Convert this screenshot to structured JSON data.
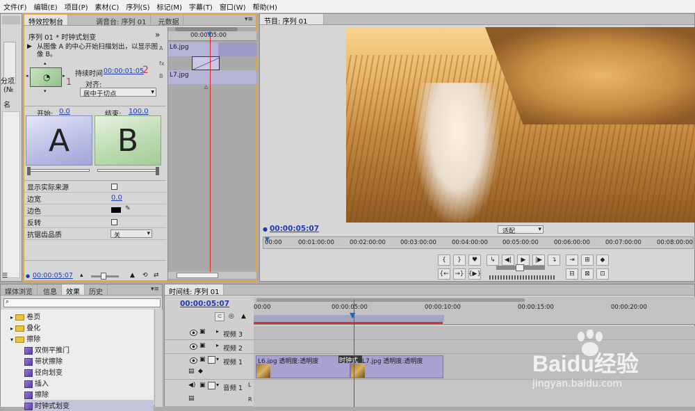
{
  "menu": [
    "文件(F)",
    "编辑(E)",
    "项目(P)",
    "素材(C)",
    "序列(S)",
    "标记(M)",
    "字幕(T)",
    "窗口(W)",
    "帮助(H)"
  ],
  "effect_controls": {
    "tabs": [
      "特效控制台",
      "调音台: 序列 01",
      "元数据"
    ],
    "title": "序列 01 * 时钟式划变",
    "description": "从图像 A 的中心开始扫描划出，以显示图像 B。",
    "duration_label": "持续时间",
    "duration_value": "00:00:01:05",
    "align_label": "对齐:",
    "align_value": "居中于切点",
    "annotation_1": "1",
    "annotation_2": "2",
    "start_label": "开始:",
    "start_value": "0.0",
    "end_label": "结束:",
    "end_value": "100.0",
    "preview_a": "A",
    "preview_b": "B",
    "props": [
      {
        "label": "显示实际来源",
        "type": "check"
      },
      {
        "label": "边宽",
        "type": "value",
        "value": "0.0"
      },
      {
        "label": "边色",
        "type": "color"
      },
      {
        "label": "反转",
        "type": "check"
      },
      {
        "label": "抗锯齿品质",
        "type": "select",
        "value": "关"
      }
    ],
    "time": "00:00:05:07",
    "mini_timeline": {
      "ruler": "00:00:05:00",
      "clip_a": "L6.jpg",
      "clip_b": "L7.jpg",
      "a_mark": "A",
      "b_mark": "B",
      "fx_mark": "fx"
    }
  },
  "left_strip": {
    "label1": "分项",
    "label2": "(№",
    "label3": "名"
  },
  "program": {
    "tab": "节目: 序列 01",
    "timecode": "00:00:05:07",
    "fit": "适配",
    "ruler": [
      "00:00",
      "00:01:00:00",
      "00:02:00:00",
      "00:03:00:00",
      "00:04:00:00",
      "00:05:00:00",
      "00:06:00:00",
      "00:07:00:00",
      "00:08:00:00"
    ]
  },
  "effects": {
    "tabs": [
      "媒体浏览",
      "信息",
      "效果",
      "历史"
    ],
    "search_placeholder": "",
    "tree": [
      {
        "label": "卷页",
        "type": "folder",
        "open": false,
        "depth": 1
      },
      {
        "label": "叠化",
        "type": "folder",
        "open": false,
        "depth": 1
      },
      {
        "label": "擦除",
        "type": "folder",
        "open": true,
        "depth": 1
      },
      {
        "label": "双侧平推门",
        "type": "fx",
        "depth": 2
      },
      {
        "label": "带状擦除",
        "type": "fx",
        "depth": 2
      },
      {
        "label": "径向划变",
        "type": "fx",
        "depth": 2
      },
      {
        "label": "插入",
        "type": "fx",
        "depth": 2
      },
      {
        "label": "擦除",
        "type": "fx",
        "depth": 2
      },
      {
        "label": "时钟式划变",
        "type": "fx",
        "depth": 2,
        "selected": true
      }
    ]
  },
  "timeline": {
    "tab": "时间线: 序列 01",
    "timecode": "00:00:05:07",
    "ruler": [
      "00:00",
      "00:00:05:00",
      "00:00:10:00",
      "00:00:15:00",
      "00:00:20:00"
    ],
    "tracks": [
      {
        "name": "视频 3",
        "kind": "video"
      },
      {
        "name": "视频 2",
        "kind": "video"
      },
      {
        "name": "视频 1",
        "kind": "video"
      },
      {
        "name": "音频 1",
        "kind": "audio"
      }
    ],
    "clip1": "L6.jpg 透明度:透明度",
    "transition": "时钟式",
    "clip2": "L7.jpg 透明度:透明度",
    "channel_l": "L",
    "channel_r": "R"
  },
  "watermark": {
    "brand": "Baidu经验",
    "url": "jingyan.baidu.com"
  }
}
